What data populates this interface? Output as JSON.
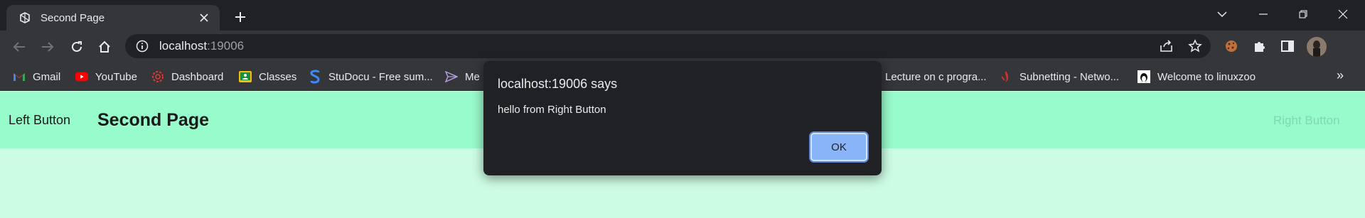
{
  "browser": {
    "tab": {
      "title": "Second Page",
      "close_icon": "close-icon",
      "favicon": "page-favicon"
    },
    "new_tab_icon": "plus-icon",
    "window_controls": [
      "chevron-down-icon",
      "minimize-icon",
      "restore-icon",
      "close-icon"
    ],
    "address": {
      "host": "localhost",
      "port": ":19006"
    },
    "bookmarks": [
      {
        "label": "Gmail",
        "icon": "gmail-icon",
        "color": "#ea4335"
      },
      {
        "label": "YouTube",
        "icon": "youtube-icon",
        "color": "#ff0000"
      },
      {
        "label": "Dashboard",
        "icon": "dashboard-icon",
        "color": "#e53935"
      },
      {
        "label": "Classes",
        "icon": "classroom-icon",
        "color": "#fbbc04"
      },
      {
        "label": "StuDocu - Free sum...",
        "icon": "studocu-icon",
        "color": "#3d8bfd"
      },
      {
        "label": "Me",
        "icon": "send-icon",
        "color": "#b39ddb"
      },
      {
        "label": "Lecture on c progra...",
        "icon": "blank-icon",
        "color": "#9aa0a6"
      },
      {
        "label": "Subnetting - Netwo...",
        "icon": "subnetting-icon",
        "color": "#d32f2f"
      },
      {
        "label": "Welcome to linuxzoo",
        "icon": "linuxzoo-icon",
        "color": "#f9d71c"
      }
    ],
    "bookmarks_more": "»"
  },
  "page": {
    "left_button": "Left Button",
    "title": "Second Page",
    "right_button": "Right Button",
    "header_color": "#98fbcb",
    "body_color": "#ccfde3"
  },
  "dialog": {
    "title": "localhost:19006 says",
    "message": "hello from Right Button",
    "ok_label": "OK"
  }
}
